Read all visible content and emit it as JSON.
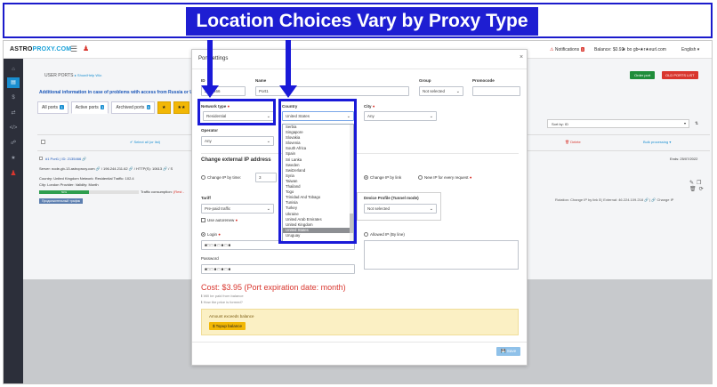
{
  "banner": {
    "title": "Location Choices Vary by Proxy Type"
  },
  "topbar": {
    "logo_main": "ASTRO",
    "logo_accent": "PROXY.COM",
    "notifications_label": "Notifications",
    "notifications_count": "3",
    "balance": "Balance: $0.92",
    "user_label": "★ bo gb•★r★eurl.com",
    "language": "English ▾"
  },
  "page": {
    "breadcrumb": "USER PORTS",
    "breadcrumb_small": "▸ Show/Help Wiz.",
    "info_link": "Additional information in case of problems with access from Russia or Ukraine",
    "tabs": [
      {
        "label": "All ports",
        "count": "1"
      },
      {
        "label": "Active ports",
        "count": "1"
      },
      {
        "label": "Archived ports",
        "count": "0"
      }
    ],
    "tab_star": "★",
    "tab_extra": "★★",
    "order_button": "Order port",
    "old_ports_button": "OLD PORTS LIST",
    "sort_by": "Sort by: ID",
    "select_all": "✔ Select all (or list)",
    "delete_label": "🗑 Delete",
    "bulk_label": "Bulk processing ▾",
    "port_id": "#1 Port1 | ID: 2135466 🔗",
    "ends": "Ends: 25/07/2022",
    "server": "Server: node-gb-13.astroproxy.com 🔗 / 196.244.211.62 🔗 / HTTP(S): 10613 🔗 / S",
    "detail_line1": "Country:  United Kingdom     Network:  Residential     Traffic:  102.4",
    "detail_line2": "City:       London              Provider:                      Validity:  Month",
    "progress_label": "50%",
    "consumption_label": "Traffic consumption:",
    "consumption_value": "(Rest - ",
    "tag": "Продолжительный трафик",
    "rotation": "Rotation: Change IP by link ℹ | External: 46.224.109.218 🔗 | 🔗 Change IP"
  },
  "modal": {
    "title": "Port settings",
    "close": "×",
    "fields": {
      "id_label": "ID",
      "id_value": "2135466",
      "name_label": "Name",
      "name_value": "Port1",
      "group_label": "Group",
      "group_value": "Not selected",
      "promocode_label": "Promocode",
      "promocode_value": "",
      "network_type_label": "Network type",
      "network_type_value": "Residential",
      "country_label": "Country",
      "country_value": "United States",
      "city_label": "City",
      "city_value": "Any",
      "operator_label": "Operator",
      "operator_value": "Any"
    },
    "external_ip_title": "Change external IP address",
    "ip_options": {
      "by_time": "Change IP by time:",
      "by_time_value": "3",
      "by_link": "Change IP by link",
      "every_request": "New IP for every request"
    },
    "tariff_label": "Tariff",
    "tariff_value": "Pre-paid traffic",
    "autorenew_label": "Use autorenew",
    "device_profile_label": "Device Profile (Tunnel mode)",
    "device_profile_value": "Not selected",
    "login_label": "Login",
    "login_value": "■□ □ ■ □ ■ □ ■",
    "allowed_ip_label": "Allowed IP (By line)",
    "password_label": "Password",
    "password_value": "■□ □ ■ □ ■ □ ■",
    "cost": "Cost: $3.95 (Port expiration date: month)",
    "hint1": "ℹ Will be paid from balance",
    "hint2": "ℹ How the price is formed?",
    "warning_text": "Amount exceeds balance",
    "topup_button": "$ Topup balance",
    "save_button": "💾 Save"
  },
  "country_dropdown": {
    "options": [
      "Serbia",
      "Singapore",
      "Slovakia",
      "Slovenia",
      "South Africa",
      "Spain",
      "Sri Lanka",
      "Sweden",
      "Switzerland",
      "Syria",
      "Taiwan",
      "Thailand",
      "Togo",
      "Trinidad And Tobago",
      "Tunisia",
      "Turkey",
      "Ukraine",
      "United Arab Emirates",
      "United Kingdom",
      "United States",
      "Uruguay"
    ],
    "selected": "United States"
  },
  "colors": {
    "annotation": "#1a1ad8",
    "banner_fill": "#1e1ed2",
    "accent": "#1a8fd1",
    "danger": "#d9362e"
  }
}
